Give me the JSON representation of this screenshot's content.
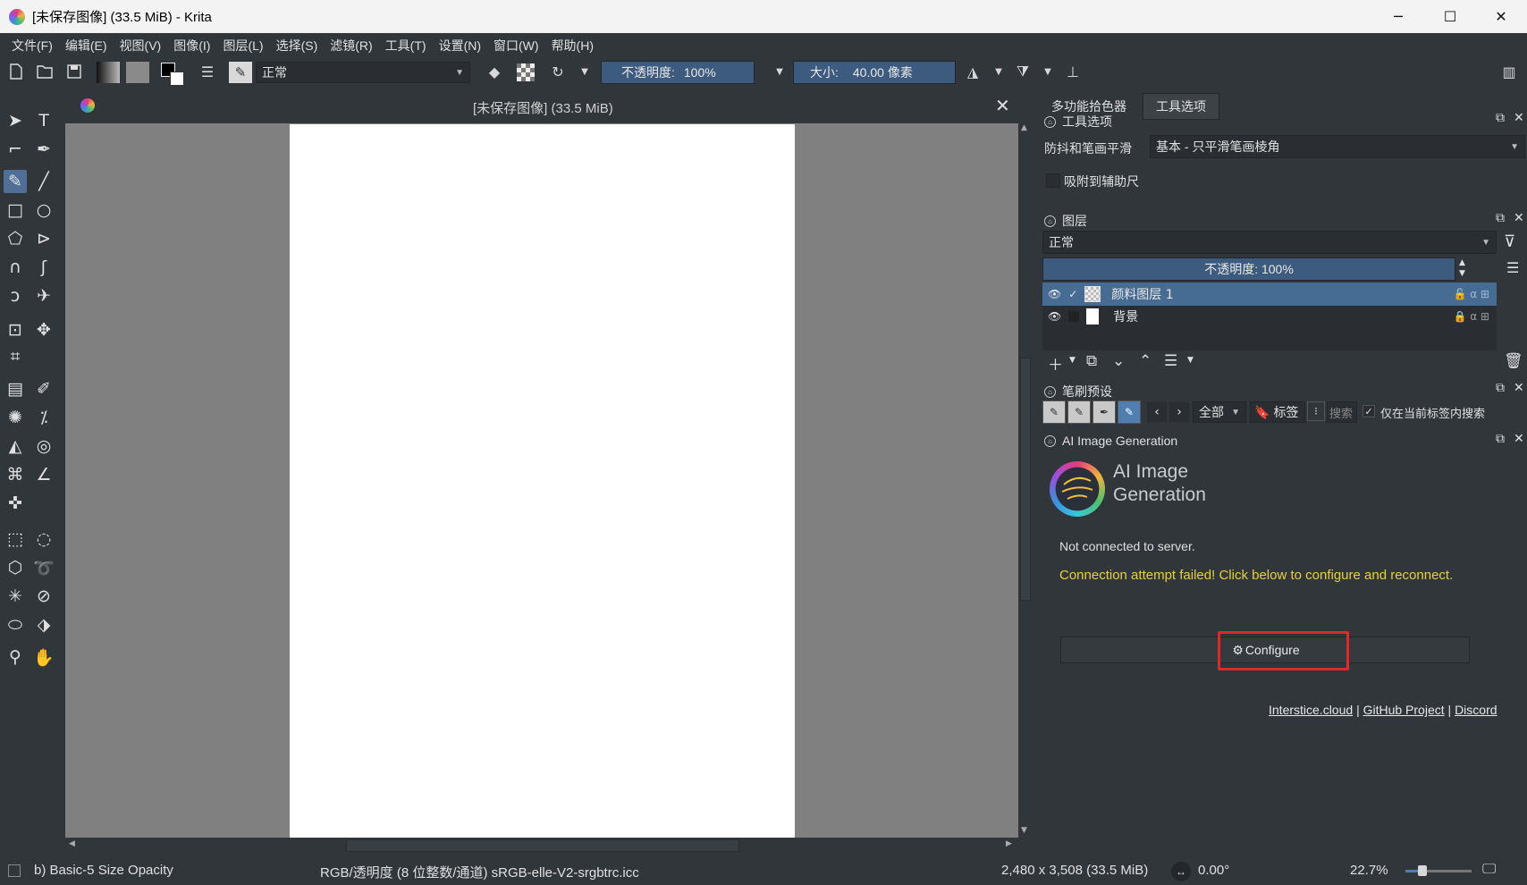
{
  "window": {
    "title": "[未保存图像]  (33.5 MiB)  - Krita",
    "minimize_glyph": "─",
    "maximize_glyph": "☐",
    "close_glyph": "✕"
  },
  "menu": [
    "文件(F)",
    "编辑(E)",
    "视图(V)",
    "图像(I)",
    "图层(L)",
    "选择(S)",
    "滤镜(R)",
    "工具(T)",
    "设置(N)",
    "窗口(W)",
    "帮助(H)"
  ],
  "toolbar": {
    "blend_mode": "正常",
    "opacity_label": "不透明度:",
    "opacity_value": "100%",
    "size_label": "大小:",
    "size_value": "40.00 像素"
  },
  "document": {
    "tab_title": "[未保存图像]  (33.5 MiB)"
  },
  "status": {
    "brush": "b) Basic-5 Size Opacity",
    "color_space": "RGB/透明度 (8 位整数/通道)  sRGB-elle-V2-srgbtrc.icc",
    "dimensions": "2,480 x 3,508 (33.5 MiB)",
    "rotation": "0.00°",
    "zoom": "22.7%"
  },
  "dock": {
    "tabs": [
      "多功能拾色器",
      "工具选项"
    ],
    "tool_options": {
      "header": "工具选项",
      "smoothing_label": "防抖和笔画平滑",
      "smoothing_value": "基本 - 只平滑笔画棱角",
      "snap_label": "吸附到辅助尺"
    },
    "layers": {
      "header": "图层",
      "blend_mode": "正常",
      "opacity": "不透明度:  100%",
      "items": [
        {
          "name": "颜料图层 1",
          "selected": true
        },
        {
          "name": "背景",
          "selected": false
        }
      ]
    },
    "brush_presets": {
      "header": "笔刷预设",
      "filter": "全部",
      "tag_label": "标签",
      "search_placeholder": "搜索",
      "current_tag_label": "仅在当前标签内搜索"
    },
    "ai": {
      "header": "AI Image Generation",
      "title_line1": "AI Image",
      "title_line2": "Generation",
      "status": "Not connected to server.",
      "error": "Connection attempt failed! Click below to configure and reconnect.",
      "configure_label": "Configure",
      "links": [
        "Interstice.cloud",
        "GitHub Project",
        "Discord"
      ],
      "separator": "|",
      "error_color": "#e6d23a",
      "highlight_color": "#e02828"
    }
  }
}
